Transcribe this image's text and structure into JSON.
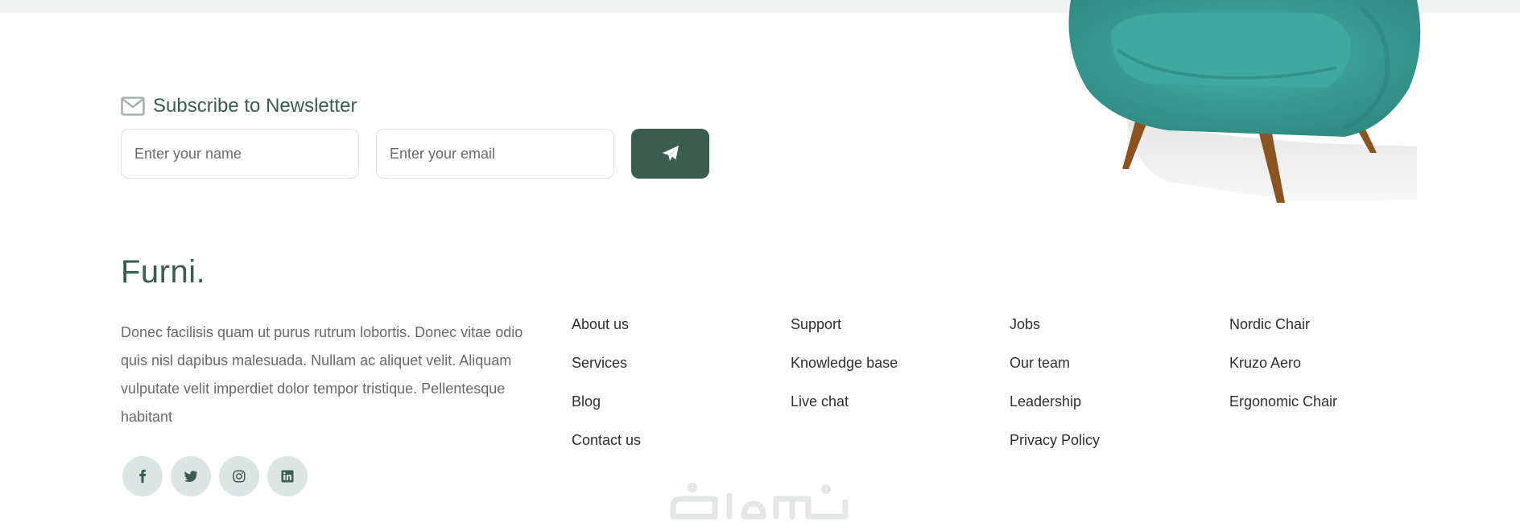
{
  "newsletter": {
    "title": "Subscribe to Newsletter",
    "icon": "envelope-icon",
    "name_placeholder": "Enter your name",
    "email_placeholder": "Enter your email",
    "submit_icon": "paper-plane-icon"
  },
  "brand": {
    "name": "Furni.",
    "description": "Donec facilisis quam ut purus rutrum lobortis. Donec vitae odio quis nisl dapibus malesuada. Nullam ac aliquet velit. Aliquam vulputate velit imperdiet dolor tempor tristique. Pellentesque habitant"
  },
  "social": [
    "facebook-icon",
    "twitter-icon",
    "instagram-icon",
    "linkedin-icon"
  ],
  "columns": [
    {
      "links": [
        "About us",
        "Services",
        "Blog",
        "Contact us"
      ]
    },
    {
      "links": [
        "Support",
        "Knowledge base",
        "Live chat"
      ]
    },
    {
      "links": [
        "Jobs",
        "Our team",
        "Leadership",
        "Privacy Policy"
      ]
    },
    {
      "links": [
        "Nordic Chair",
        "Kruzo Aero",
        "Ergonomic Chair"
      ]
    }
  ],
  "colors": {
    "primary": "#3b5d50",
    "chair": "#3aa39a",
    "social_bg": "#dce5e4",
    "text_muted": "#6a6a6a"
  }
}
